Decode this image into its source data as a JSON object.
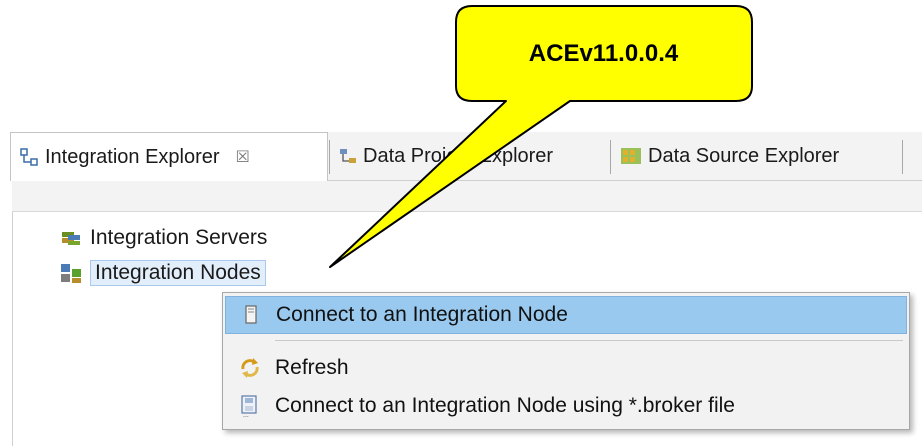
{
  "callout": {
    "text": "ACEv11.0.0.4"
  },
  "tabs": [
    {
      "label": "Integration Explorer",
      "icon": "integration-explorer-icon",
      "active": true,
      "close": "☒"
    },
    {
      "label": "Data Project Explorer",
      "icon": "data-project-explorer-icon",
      "active": false
    },
    {
      "label": "Data Source Explorer",
      "icon": "data-source-explorer-icon",
      "active": false
    }
  ],
  "tree": [
    {
      "label": "Integration Servers",
      "icon": "integration-servers-icon"
    },
    {
      "label": "Integration Nodes",
      "icon": "integration-nodes-icon",
      "selected": true
    }
  ],
  "context_menu": {
    "items": [
      {
        "label": "Connect to an Integration Node",
        "icon": "connect-node-icon",
        "highlighted": true
      },
      {
        "label": "Refresh",
        "icon": "refresh-icon"
      },
      {
        "label": "Connect to an Integration Node using *.broker file",
        "icon": "broker-file-icon"
      }
    ]
  },
  "colors": {
    "callout_fill": "#ffff00",
    "menu_highlight": "#99c9ef"
  }
}
